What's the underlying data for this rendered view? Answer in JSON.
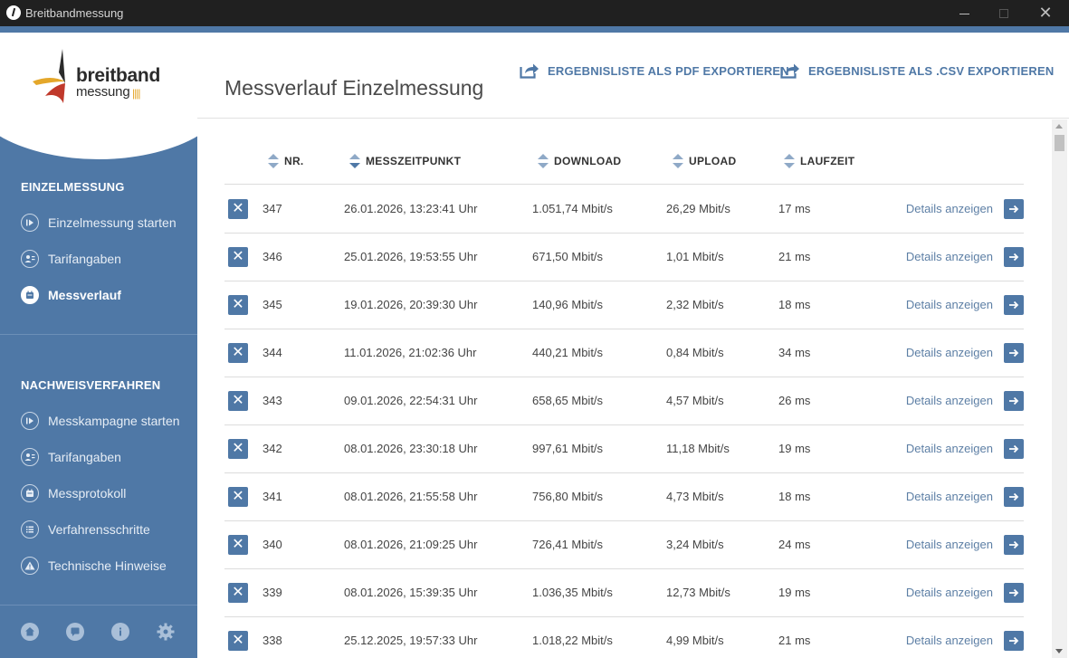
{
  "window": {
    "title": "Breitbandmessung",
    "close_glyph": "✕"
  },
  "logo": {
    "line1": "breitband",
    "line2": "messung",
    "bars": "||||"
  },
  "colors": {
    "accent": "#4f78a6",
    "sidebar": "#4f78a6",
    "titlebar": "#202020",
    "logo_red": "#c0392b",
    "logo_yellow": "#e4a72a"
  },
  "sidebar": {
    "section1": "EINZELMESSUNG",
    "items1": [
      {
        "label": "Einzelmessung starten",
        "icon": "play-icon",
        "active": false
      },
      {
        "label": "Tarifangaben",
        "icon": "user-card-icon",
        "active": false
      },
      {
        "label": "Messverlauf",
        "icon": "calendar-icon",
        "active": true
      }
    ],
    "section2": "NACHWEISVERFAHREN",
    "items2": [
      {
        "label": "Messkampagne starten",
        "icon": "play-icon"
      },
      {
        "label": "Tarifangaben",
        "icon": "user-card-icon"
      },
      {
        "label": "Messprotokoll",
        "icon": "calendar-icon"
      },
      {
        "label": "Verfahrensschritte",
        "icon": "list-icon"
      },
      {
        "label": "Technische Hinweise",
        "icon": "warning-icon"
      }
    ],
    "bottom_icons": [
      "home-icon",
      "chat-icon",
      "info-icon",
      "gear-icon"
    ]
  },
  "main": {
    "title": "Messverlauf Einzelmessung",
    "export_pdf": "ERGEBNISLISTE ALS PDF EXPORTIEREN",
    "export_csv": "ERGEBNISLISTE ALS .CSV EXPORTIEREN"
  },
  "table": {
    "headers": {
      "nr": "NR.",
      "time": "MESSZEITPUNKT",
      "download": "DOWNLOAD",
      "upload": "UPLOAD",
      "latency": "LAUFZEIT"
    },
    "delete_glyph": "✕",
    "details_label": "Details anzeigen",
    "rows": [
      {
        "nr": "347",
        "time": "26.01.2026, 13:23:41 Uhr",
        "download": "1.051,74 Mbit/s",
        "upload": "26,29 Mbit/s",
        "latency": "17 ms"
      },
      {
        "nr": "346",
        "time": "25.01.2026, 19:53:55 Uhr",
        "download": "671,50 Mbit/s",
        "upload": "1,01 Mbit/s",
        "latency": "21 ms"
      },
      {
        "nr": "345",
        "time": "19.01.2026, 20:39:30 Uhr",
        "download": "140,96 Mbit/s",
        "upload": "2,32 Mbit/s",
        "latency": "18 ms"
      },
      {
        "nr": "344",
        "time": "11.01.2026, 21:02:36 Uhr",
        "download": "440,21 Mbit/s",
        "upload": "0,84 Mbit/s",
        "latency": "34 ms"
      },
      {
        "nr": "343",
        "time": "09.01.2026, 22:54:31 Uhr",
        "download": "658,65 Mbit/s",
        "upload": "4,57 Mbit/s",
        "latency": "26 ms"
      },
      {
        "nr": "342",
        "time": "08.01.2026, 23:30:18 Uhr",
        "download": "997,61 Mbit/s",
        "upload": "11,18 Mbit/s",
        "latency": "19 ms"
      },
      {
        "nr": "341",
        "time": "08.01.2026, 21:55:58 Uhr",
        "download": "756,80 Mbit/s",
        "upload": "4,73 Mbit/s",
        "latency": "18 ms"
      },
      {
        "nr": "340",
        "time": "08.01.2026, 21:09:25 Uhr",
        "download": "726,41 Mbit/s",
        "upload": "3,24 Mbit/s",
        "latency": "24 ms"
      },
      {
        "nr": "339",
        "time": "08.01.2026, 15:39:35 Uhr",
        "download": "1.036,35 Mbit/s",
        "upload": "12,73 Mbit/s",
        "latency": "19 ms"
      },
      {
        "nr": "338",
        "time": "25.12.2025, 19:57:33 Uhr",
        "download": "1.018,22 Mbit/s",
        "upload": "4,99 Mbit/s",
        "latency": "21 ms"
      }
    ]
  }
}
